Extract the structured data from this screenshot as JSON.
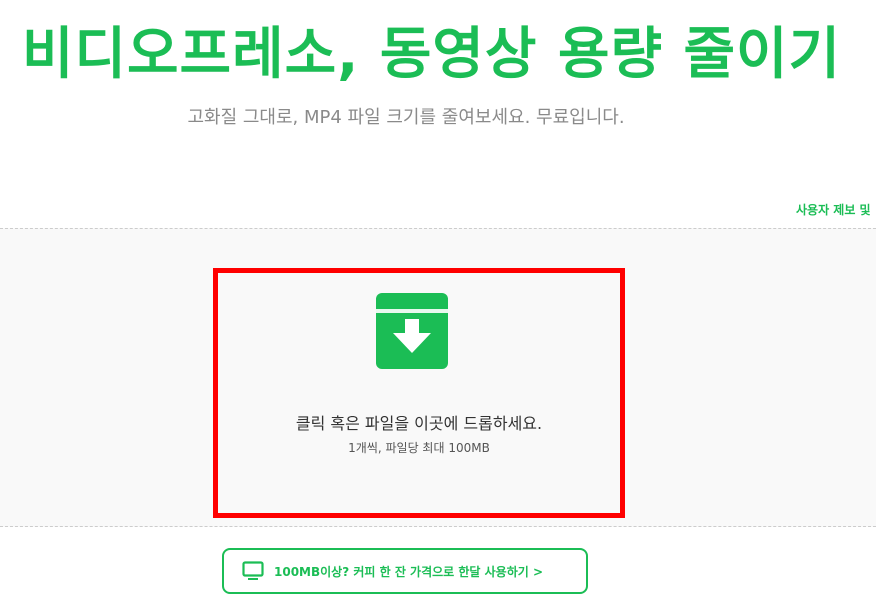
{
  "hero": {
    "title": "비디오프레소, 동영상 용량 줄이기",
    "subtitle": "고화질 그대로, MP4 파일 크기를 줄여보세요. 무료입니다."
  },
  "report_link": {
    "label": "사용자 제보 및"
  },
  "dropzone": {
    "icon": "download-box-icon",
    "instruction": "클릭 혹은 파일을 이곳에 드롭하세요.",
    "limit": "1개씩, 파일당 최대 100MB"
  },
  "premium": {
    "icon": "monitor-icon",
    "label": "100MB이상? 커피 한 잔 가격으로 한달 사용하기 >"
  },
  "colors": {
    "brand_green": "#1bbd55",
    "highlight_red": "#ff0000",
    "drop_bg": "#f9f9f9"
  }
}
